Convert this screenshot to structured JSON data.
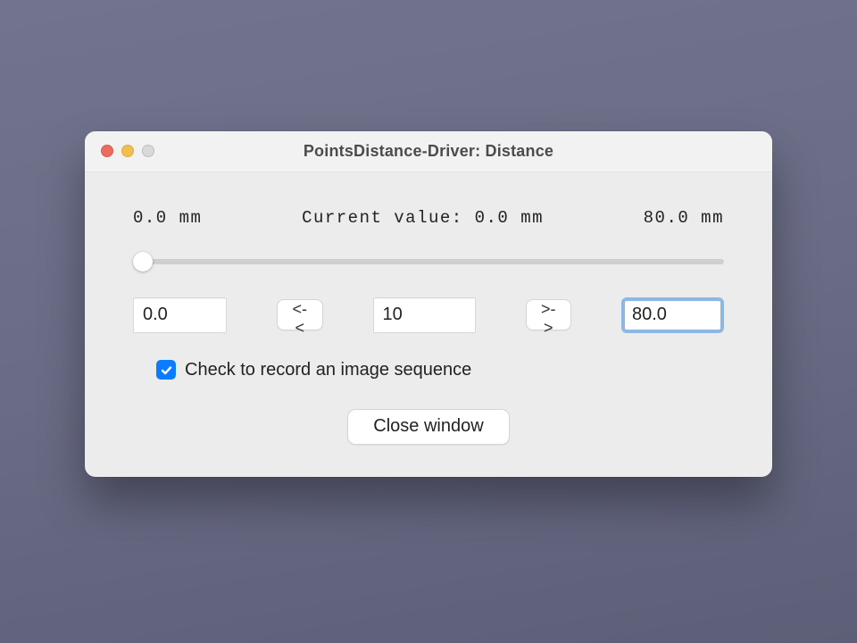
{
  "window": {
    "title": "PointsDistance-Driver: Distance"
  },
  "labels": {
    "min": "0.0 mm",
    "current": "Current value: 0.0 mm",
    "max": "80.0 mm"
  },
  "slider": {
    "min": 0,
    "max": 80,
    "value": 0
  },
  "inputs": {
    "min_value": "0.0",
    "step_value": "10",
    "max_value": "80.0"
  },
  "buttons": {
    "step_back": "<-<",
    "step_forward": ">->",
    "close": "Close window"
  },
  "checkbox": {
    "checked": true,
    "label": "Check to record an image sequence"
  }
}
